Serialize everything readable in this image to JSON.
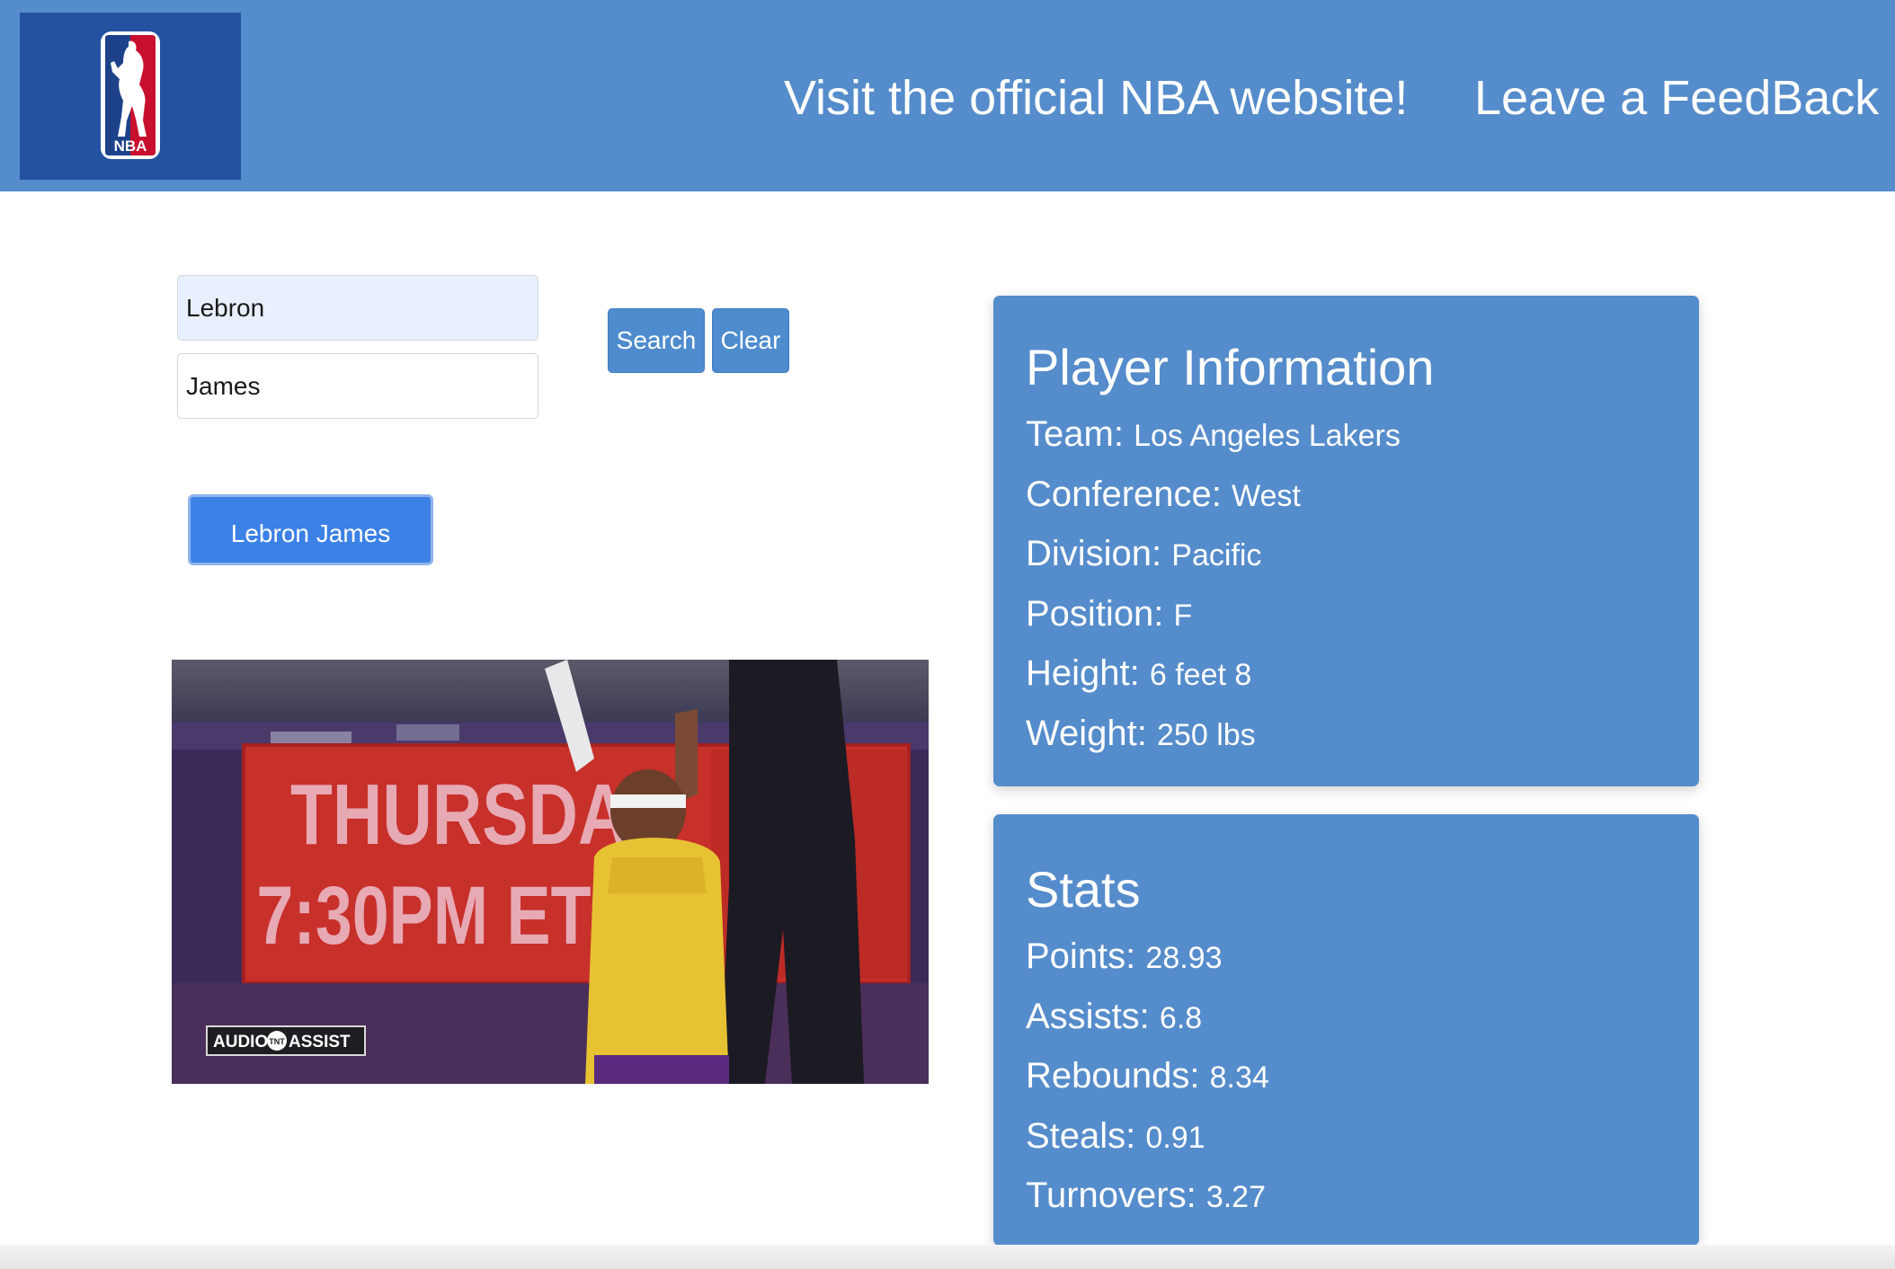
{
  "header": {
    "logo_text": "NBA",
    "links": {
      "nba_site": "Visit the official NBA website!",
      "feedback": "Leave a FeedBack"
    }
  },
  "search": {
    "first_name_value": "Lebron",
    "last_name_value": "James",
    "search_label": "Search",
    "clear_label": "Clear"
  },
  "results": [
    {
      "label": "Lebron James"
    }
  ],
  "media": {
    "sign_line1": "THURSDA",
    "sign_line2": "7:30PM ET",
    "badge_left": "AUDIO",
    "badge_mid": "TNT",
    "badge_right": "ASSIST"
  },
  "player_info": {
    "title": "Player Information",
    "rows": [
      {
        "label": "Team:",
        "value": "Los Angeles Lakers"
      },
      {
        "label": "Conference:",
        "value": "West"
      },
      {
        "label": "Division:",
        "value": "Pacific"
      },
      {
        "label": "Position:",
        "value": "F"
      },
      {
        "label": "Height:",
        "value": "6 feet 8"
      },
      {
        "label": "Weight:",
        "value": "250 lbs"
      }
    ]
  },
  "stats": {
    "title": "Stats",
    "rows": [
      {
        "label": "Points:",
        "value": "28.93"
      },
      {
        "label": "Assists:",
        "value": "6.8"
      },
      {
        "label": "Rebounds:",
        "value": "8.34"
      },
      {
        "label": "Steals:",
        "value": "0.91"
      },
      {
        "label": "Turnovers:",
        "value": "3.27"
      }
    ]
  },
  "colors": {
    "header": "#558ccb",
    "logo_bg": "#2452a1",
    "card": "#558ccb",
    "result_button": "#3c81e6"
  }
}
